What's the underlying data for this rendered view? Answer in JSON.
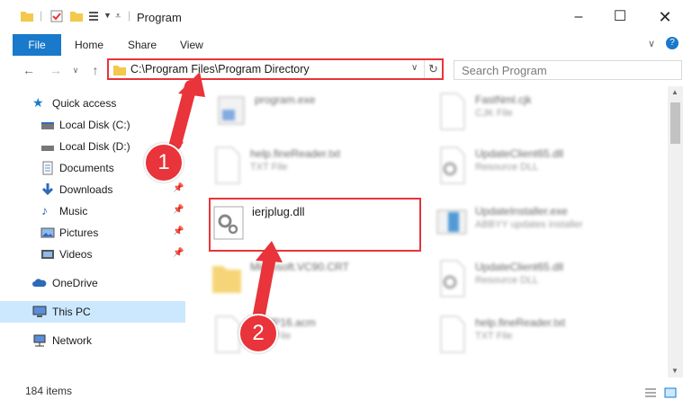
{
  "window": {
    "title": "Program"
  },
  "ribbon": {
    "tabs": [
      "File",
      "Home",
      "Share",
      "View"
    ]
  },
  "navigation": {
    "address": "C:\\Program Files\\Program Directory",
    "search_placeholder": "Search Program"
  },
  "sidebar": {
    "items": [
      {
        "label": "Quick access",
        "icon": "star-icon"
      },
      {
        "label": "Local Disk (C:)",
        "icon": "drive-icon",
        "pinned": true
      },
      {
        "label": "Local Disk (D:)",
        "icon": "drive-icon",
        "pinned": true
      },
      {
        "label": "Documents",
        "icon": "documents-icon",
        "pinned": true
      },
      {
        "label": "Downloads",
        "icon": "download-icon",
        "pinned": true
      },
      {
        "label": "Music",
        "icon": "music-icon",
        "pinned": true
      },
      {
        "label": "Pictures",
        "icon": "pictures-icon",
        "pinned": true
      },
      {
        "label": "Videos",
        "icon": "videos-icon",
        "pinned": true
      },
      {
        "label": "OneDrive",
        "icon": "cloud-icon"
      },
      {
        "label": "This PC",
        "icon": "computer-icon",
        "selected": true
      },
      {
        "label": "Network",
        "icon": "network-icon"
      }
    ]
  },
  "files": [
    {
      "name": "program.exe",
      "type": ""
    },
    {
      "name": "FastNml.cjk",
      "type": "CJK File"
    },
    {
      "name": "help.fineReader.txt",
      "type": "TXT File"
    },
    {
      "name": "UpdateClient65.dll",
      "type": "Resource DLL"
    },
    {
      "name": "ierjplug.dll",
      "type": ""
    },
    {
      "name": "UpdateInstaller.exe",
      "type": "ABBYY updates installer"
    },
    {
      "name": "Microsoft.VC90.CRT",
      "type": ""
    },
    {
      "name": "UpdateClient65.dll",
      "type": "Resource DLL"
    },
    {
      "name": "FoWP16.acm",
      "type": "ACM File"
    },
    {
      "name": "help.fineReader.txt",
      "type": "TXT File"
    }
  ],
  "status": {
    "count": "184 items"
  },
  "annotations": {
    "step1": "1",
    "step2": "2"
  },
  "colors": {
    "accent": "#1979ca",
    "highlight": "#e8343a",
    "selected_bg": "#cce8ff"
  }
}
